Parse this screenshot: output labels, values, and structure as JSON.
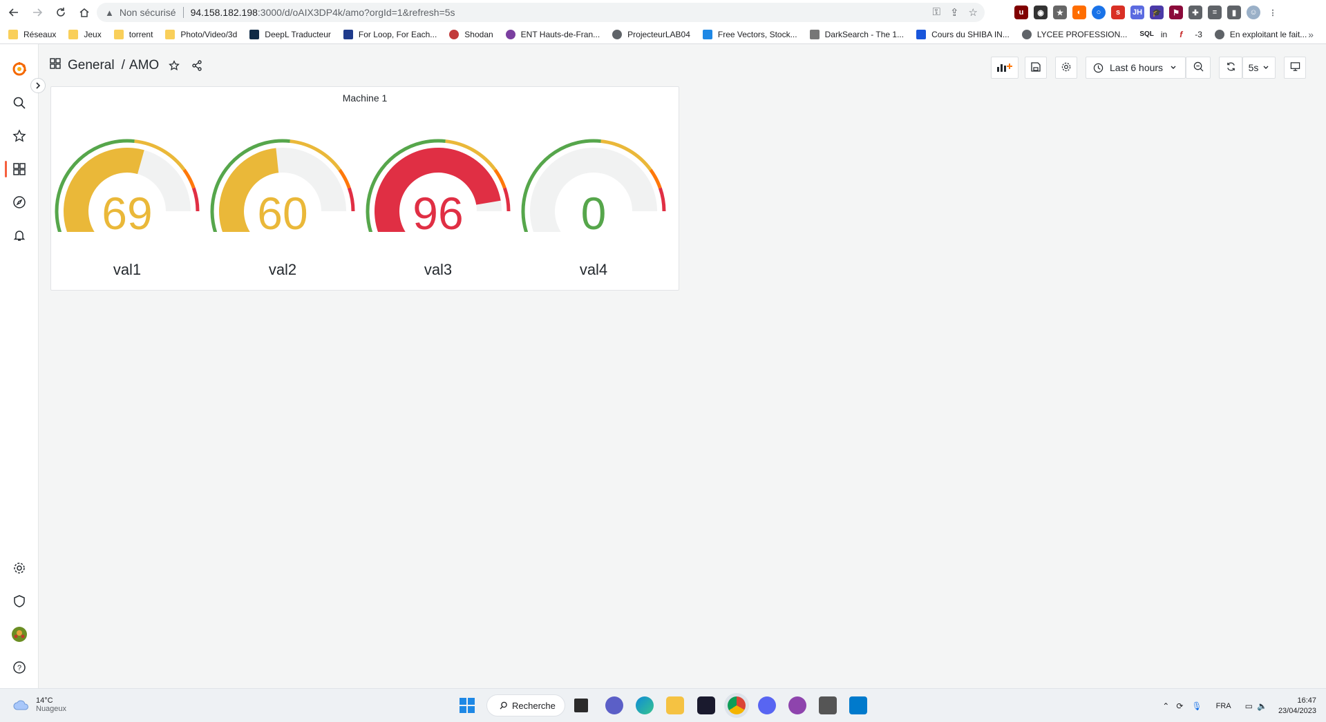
{
  "browser": {
    "security_label": "Non sécurisé",
    "url_host": "94.158.182.198",
    "url_path": ":3000/d/oAIX3DP4k/amo?orgId=1&refresh=5s",
    "bookmarks": [
      {
        "label": "Réseaux",
        "icon": "folder-icon"
      },
      {
        "label": "Jeux",
        "icon": "folder-icon"
      },
      {
        "label": "torrent",
        "icon": "folder-icon"
      },
      {
        "label": "Photo/Video/3d",
        "icon": "folder-icon"
      },
      {
        "label": "DeepL Traducteur",
        "icon": "deepl-icon"
      },
      {
        "label": "For Loop, For Each...",
        "icon": "site-icon"
      },
      {
        "label": "Shodan",
        "icon": "shodan-icon"
      },
      {
        "label": "ENT Hauts-de-Fran...",
        "icon": "ent-icon"
      },
      {
        "label": "ProjecteurLAB04",
        "icon": "globe-icon"
      },
      {
        "label": "Free Vectors, Stock...",
        "icon": "vector-icon"
      },
      {
        "label": "DarkSearch - The 1...",
        "icon": "darksearch-icon"
      },
      {
        "label": "Cours du SHIBA IN...",
        "icon": "coin-icon"
      },
      {
        "label": "LYCEE PROFESSION...",
        "icon": "globe-icon"
      },
      {
        "label": "SQL",
        "icon": "sql-icon"
      },
      {
        "label": "in",
        "icon": "linkedin-icon"
      },
      {
        "label": "-3",
        "icon": "function-icon"
      },
      {
        "label": "En exploitant le fait...",
        "icon": "globe-icon"
      }
    ]
  },
  "dashboard": {
    "folder": "General",
    "separator": "/",
    "title": "AMO",
    "time_range": "Last 6 hours",
    "refresh_interval": "5s"
  },
  "panel": {
    "title": "Machine 1",
    "gauges": [
      {
        "label": "val1",
        "value": "69",
        "fraction": 0.69,
        "color": "#eab839"
      },
      {
        "label": "val2",
        "value": "60",
        "fraction": 0.6,
        "color": "#eab839"
      },
      {
        "label": "val3",
        "value": "96",
        "fraction": 0.96,
        "color": "#e02f44"
      },
      {
        "label": "val4",
        "value": "0",
        "fraction": 0.0,
        "color": "#56a64b"
      }
    ],
    "thresholds": [
      {
        "from": 0,
        "to": 0.65,
        "color": "#56a64b"
      },
      {
        "from": 0.65,
        "to": 0.85,
        "color": "#eab839"
      },
      {
        "from": 0.85,
        "to": 0.92,
        "color": "#ff780a"
      },
      {
        "from": 0.92,
        "to": 1.0,
        "color": "#e02f44"
      }
    ]
  },
  "taskbar": {
    "temperature": "14°C",
    "weather": "Nuageux",
    "search": "Recherche",
    "language": "FRA",
    "time": "16:47",
    "date": "23/04/2023"
  }
}
